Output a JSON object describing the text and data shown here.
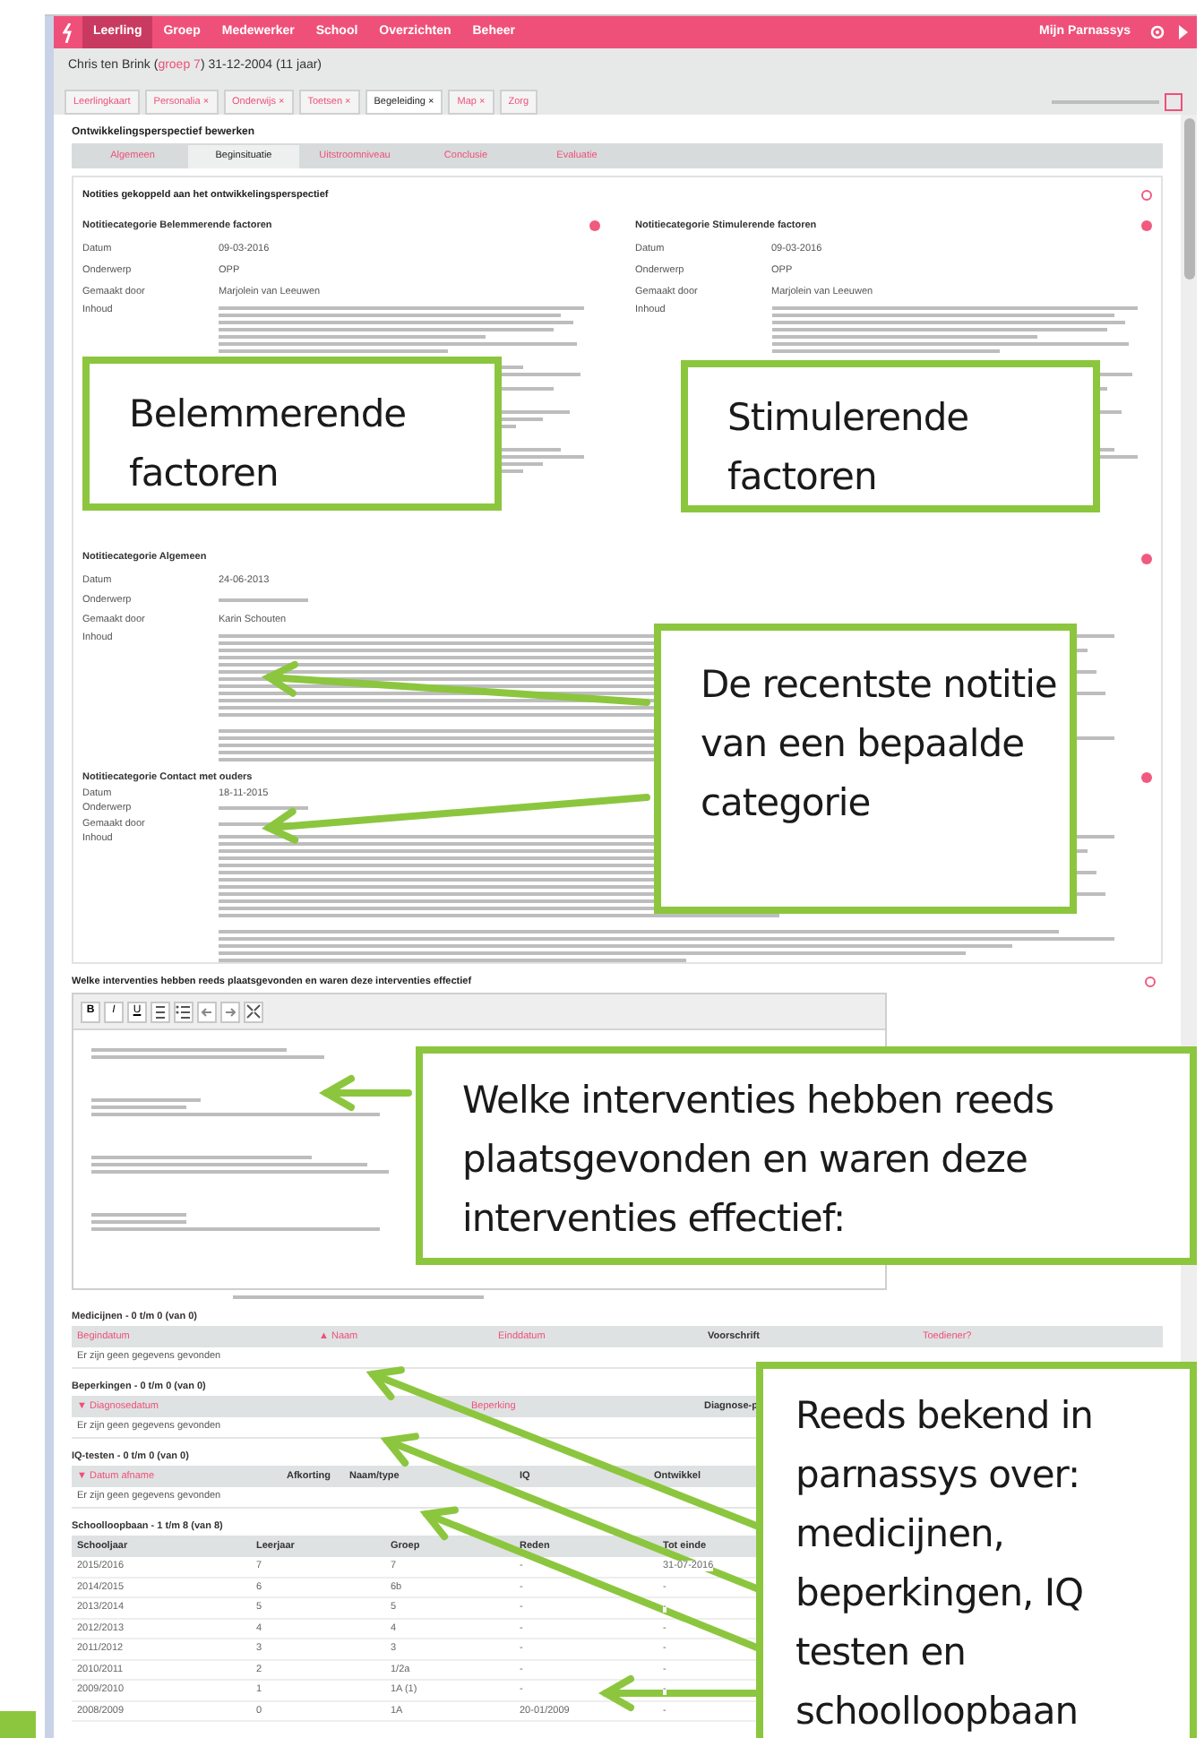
{
  "nav": {
    "items": [
      {
        "label": "Leerling",
        "selected": true
      },
      {
        "label": "Groep",
        "selected": false
      },
      {
        "label": "Medewerker",
        "selected": false
      },
      {
        "label": "School",
        "selected": false
      },
      {
        "label": "Overzichten",
        "selected": false
      },
      {
        "label": "Beheer",
        "selected": false
      }
    ],
    "account": "Mijn Parnassys"
  },
  "student": {
    "prefix": "Chris ten Brink (",
    "group": "groep 7",
    "suffix": ") 31-12-2004 (11 jaar)"
  },
  "tabs": [
    {
      "label": "Leerlingkaart",
      "selected": false
    },
    {
      "label": "Personalia ×",
      "selected": false
    },
    {
      "label": "Onderwijs ×",
      "selected": false
    },
    {
      "label": "Toetsen ×",
      "selected": false
    },
    {
      "label": "Begeleiding ×",
      "selected": true
    },
    {
      "label": "Map ×",
      "selected": false
    },
    {
      "label": "Zorg",
      "selected": false
    }
  ],
  "page_title": "Ontwikkelingsperspectief bewerken",
  "subtabs": [
    {
      "label": "Algemeen",
      "selected": false
    },
    {
      "label": "Beginsituatie",
      "selected": true
    },
    {
      "label": "Uitstroomniveau",
      "selected": false
    },
    {
      "label": "Conclusie",
      "selected": false
    },
    {
      "label": "Evaluatie",
      "selected": false
    }
  ],
  "notes": {
    "title": "Notities gekoppeld aan het ontwikkelingsperspectief",
    "rows": [
      [
        {
          "title": "Notitiecategorie Belemmerende factoren",
          "fields": [
            {
              "kind": "line",
              "label": "Datum",
              "value": "09-03-2016"
            },
            {
              "kind": "line",
              "label": "Onderwerp",
              "value": "OPP"
            },
            {
              "kind": "line",
              "label": "Gemaakt door",
              "value": "Marjolein van Leeuwen"
            },
            {
              "kind": "block",
              "label": "Inhoud"
            }
          ]
        },
        {
          "title": "Notitiecategorie Stimulerende factoren",
          "fields": [
            {
              "kind": "line",
              "label": "Datum",
              "value": "09-03-2016"
            },
            {
              "kind": "line",
              "label": "Onderwerp",
              "value": "OPP"
            },
            {
              "kind": "line",
              "label": "Gemaakt door",
              "value": "Marjolein van Leeuwen"
            },
            {
              "kind": "block",
              "label": "Inhoud"
            }
          ]
        }
      ],
      [
        {
          "title": "Notitiecategorie Algemeen",
          "fields": [
            {
              "kind": "line",
              "label": "Datum",
              "value": "24-06-2013"
            },
            {
              "kind": "line",
              "label": "Onderwerp"
            },
            {
              "kind": "line",
              "label": "Gemaakt door",
              "value": "Karin Schouten"
            },
            {
              "kind": "block",
              "label": "Inhoud"
            }
          ]
        }
      ],
      [
        {
          "title": "Notitiecategorie Contact met ouders",
          "fields": [
            {
              "kind": "line",
              "label": "Datum",
              "value": "18-11-2015"
            },
            {
              "kind": "line",
              "label": "Onderwerp"
            },
            {
              "kind": "line",
              "label": "Gemaakt door"
            },
            {
              "kind": "block",
              "label": "Inhoud"
            }
          ]
        }
      ]
    ]
  },
  "question": {
    "title": "Welke interventies hebben reeds plaatsgevonden en waren deze interventies effectief",
    "toolbar": [
      {
        "kind": "bold",
        "label": "B"
      },
      {
        "kind": "italic",
        "label": "I"
      },
      {
        "kind": "underline",
        "label": "U"
      },
      {
        "kind": "numbered-list"
      },
      {
        "kind": "bulleted-list"
      },
      {
        "kind": "undo"
      },
      {
        "kind": "redo"
      },
      {
        "kind": "fullscreen"
      }
    ]
  },
  "tables": [
    {
      "title": "Medicijnen - 0 t/m 0 (van 0)",
      "columns": [
        {
          "label": "Begindatum",
          "sortable": true
        },
        {
          "label": "▲ Naam",
          "sortable": true
        },
        {
          "label": "Einddatum",
          "sortable": true
        },
        {
          "label": "Voorschrift",
          "sortable": false
        },
        {
          "label": "Toediener?",
          "sortable": true
        }
      ],
      "empty": "Er zijn geen gegevens gevonden"
    },
    {
      "title": "Beperkingen - 0 t/m 0 (van 0)",
      "columns": [
        {
          "label": "▼ Diagnosedatum",
          "sortable": true
        },
        {
          "label": "Beperking",
          "sortable": true
        },
        {
          "label": "Diagnose-p",
          "sortable": false
        }
      ],
      "empty": "Er zijn geen gegevens gevonden"
    },
    {
      "title": "IQ-testen - 0 t/m 0 (van 0)",
      "columns": [
        {
          "label": "▼ Datum afname",
          "sortable": true
        },
        {
          "label": "Afkorting",
          "sortable": false
        },
        {
          "label": "Naam/type",
          "sortable": false
        },
        {
          "label": "IQ",
          "sortable": false
        },
        {
          "label": "Ontwikkel",
          "sortable": false
        }
      ],
      "empty": "Er zijn geen gegevens gevonden"
    },
    {
      "title": "Schoolloopbaan - 1 t/m 8 (van 8)",
      "columns": [
        {
          "label": "Schooljaar",
          "sortable": false
        },
        {
          "label": "Leerjaar",
          "sortable": false
        },
        {
          "label": "Groep",
          "sortable": false
        },
        {
          "label": "Reden",
          "sortable": false
        },
        {
          "label": "Tot einde",
          "sortable": false
        }
      ],
      "rows": [
        [
          "2015/2016",
          "7",
          "7",
          "-",
          "31-07-2016"
        ],
        [
          "2014/2015",
          "6",
          "6b",
          "-",
          "-"
        ],
        [
          "2013/2014",
          "5",
          "5",
          "-",
          "-"
        ],
        [
          "2012/2013",
          "4",
          "4",
          "-",
          "-"
        ],
        [
          "2011/2012",
          "3",
          "3",
          "-",
          "-"
        ],
        [
          "2010/2011",
          "2",
          "1/2a",
          "-",
          "-"
        ],
        [
          "2009/2010",
          "1",
          "1A (1)",
          "-",
          "-"
        ],
        [
          "2008/2009",
          "0",
          "1A",
          "20-01/2009",
          "-"
        ]
      ]
    }
  ],
  "callouts": [
    {
      "text": "Belemmerende factoren"
    },
    {
      "text": "Stimulerende factoren"
    },
    {
      "text": "De recentste notitie van een bepaalde categorie"
    },
    {
      "text": "Welke interventies hebben reeds plaatsgevonden en waren deze interventies effectief:"
    },
    {
      "text": "Reeds bekend in parnassys over: medicijnen, beperkingen, IQ testen en schoolloopbaan"
    }
  ]
}
